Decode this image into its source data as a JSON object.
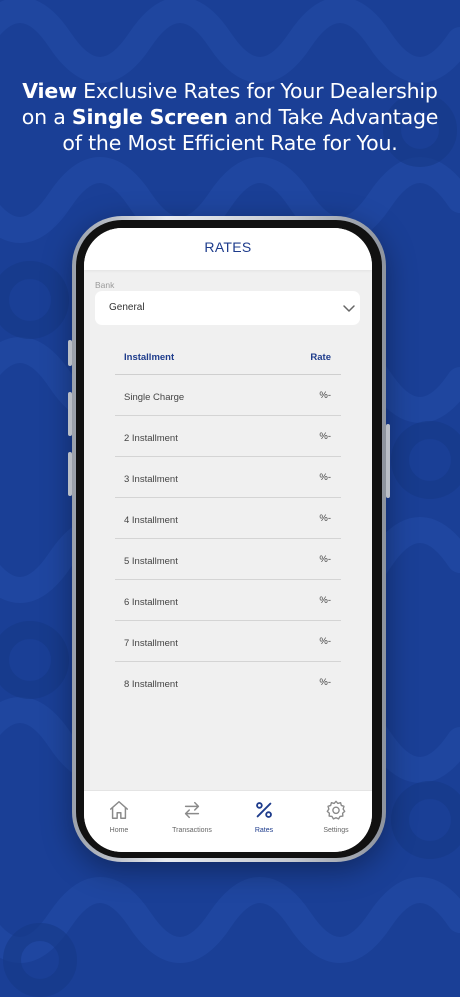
{
  "headline": {
    "line1_bold": "View",
    "line1_rest": " Exclusive Rates for Your Dealership",
    "line2_pre": "on a ",
    "line2_bold": "Single Screen",
    "line2_post": " and Take Advantage",
    "line3": "of the Most Efficient Rate for You."
  },
  "app": {
    "title": "RATES",
    "bank_label": "Bank",
    "bank_selected": "General"
  },
  "table": {
    "headers": {
      "installment": "Installment",
      "rate": "Rate"
    },
    "rows": [
      {
        "name": "Single Charge",
        "rate": "%-"
      },
      {
        "name": "2 Installment",
        "rate": "%-"
      },
      {
        "name": "3 Installment",
        "rate": "%-"
      },
      {
        "name": "4 Installment",
        "rate": "%-"
      },
      {
        "name": "5 Installment",
        "rate": "%-"
      },
      {
        "name": "6 Installment",
        "rate": "%-"
      },
      {
        "name": "7 Installment",
        "rate": "%-"
      },
      {
        "name": "8 Installment",
        "rate": "%-"
      }
    ]
  },
  "tabs": [
    {
      "label": "Home",
      "icon": "home-icon",
      "active": false
    },
    {
      "label": "Transactions",
      "icon": "transfer-icon",
      "active": false
    },
    {
      "label": "Rates",
      "icon": "percent-icon",
      "active": true
    },
    {
      "label": "Settings",
      "icon": "gear-icon",
      "active": false
    }
  ],
  "colors": {
    "background": "#1a3f96",
    "accent": "#1e3c8c",
    "screen_bg": "#f0f0f0",
    "icon_inactive": "#8a8a8a"
  }
}
